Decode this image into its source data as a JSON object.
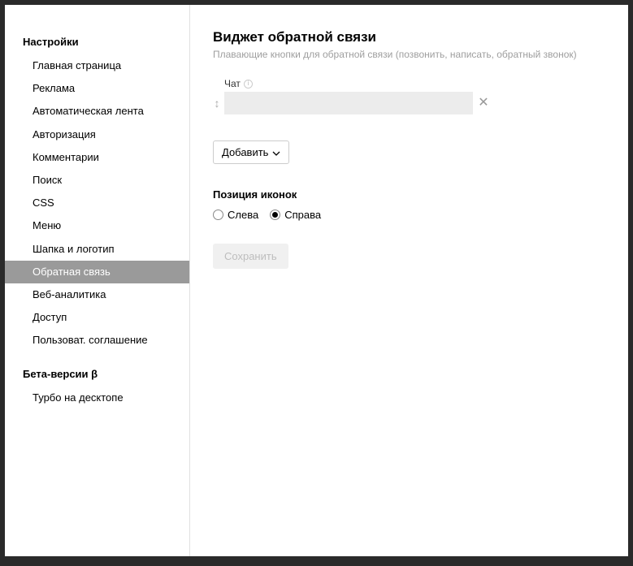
{
  "sidebar": {
    "group1": {
      "title": "Настройки",
      "items": [
        {
          "label": "Главная страница"
        },
        {
          "label": "Реклама"
        },
        {
          "label": "Автоматическая лента"
        },
        {
          "label": "Авторизация"
        },
        {
          "label": "Комментарии"
        },
        {
          "label": "Поиск"
        },
        {
          "label": "CSS"
        },
        {
          "label": "Меню"
        },
        {
          "label": "Шапка и логотип"
        },
        {
          "label": "Обратная связь"
        },
        {
          "label": "Веб-аналитика"
        },
        {
          "label": "Доступ"
        },
        {
          "label": "Пользоват. соглашение"
        }
      ],
      "active_index": 9
    },
    "group2": {
      "title": "Бета-версии β",
      "items": [
        {
          "label": "Турбо на десктопе"
        }
      ]
    }
  },
  "main": {
    "title": "Виджет обратной связи",
    "subtitle": "Плавающие кнопки для обратной связи (позвонить, написать, обратный звонок)",
    "field": {
      "label": "Чат",
      "value": ""
    },
    "add_button_label": "Добавить",
    "position_section": {
      "title": "Позиция иконок",
      "options": [
        {
          "label": "Слева",
          "selected": false
        },
        {
          "label": "Справа",
          "selected": true
        }
      ]
    },
    "save_label": "Сохранить"
  }
}
